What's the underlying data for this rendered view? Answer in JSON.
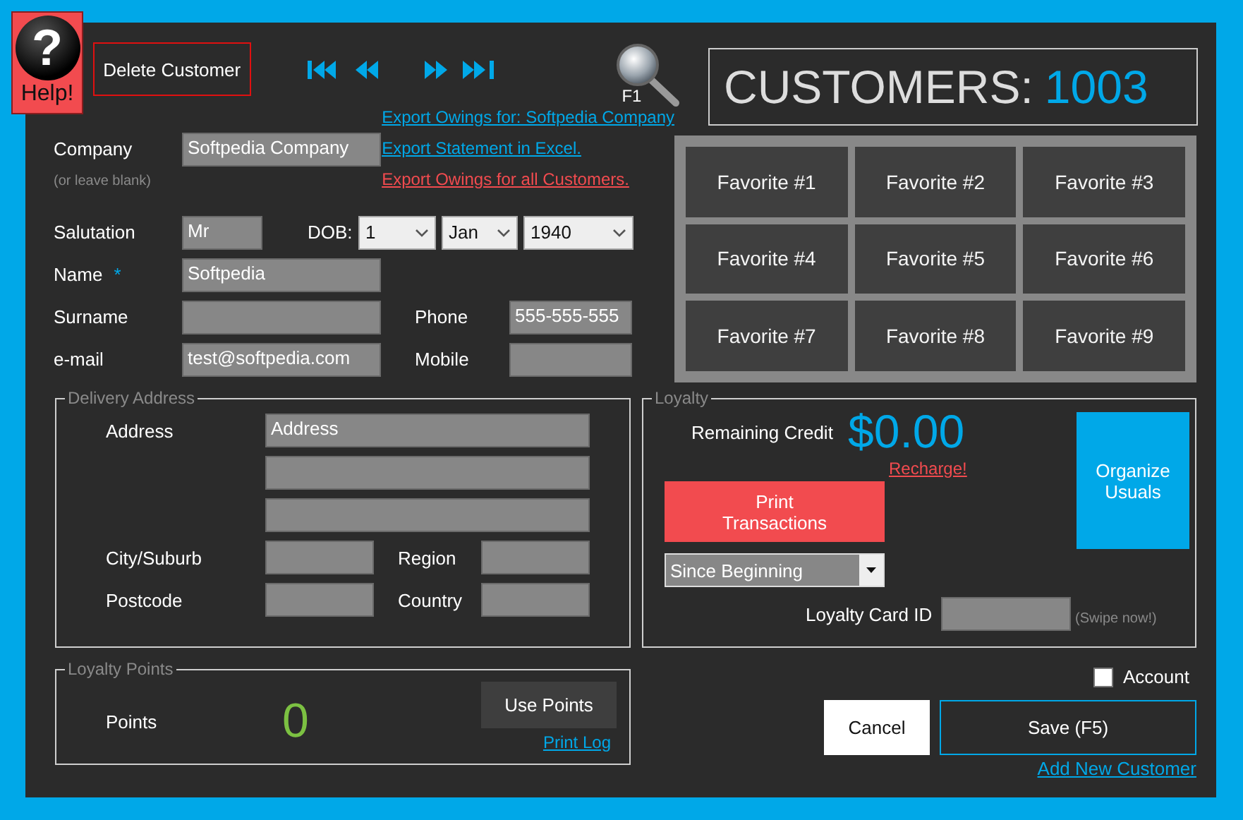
{
  "help_button": {
    "symbol": "?",
    "label": "Help!"
  },
  "delete_button": {
    "label": "Delete Customer"
  },
  "search": {
    "hotkey": "F1"
  },
  "customers": {
    "label": "CUSTOMERS:",
    "count": "1003"
  },
  "export_links": [
    {
      "label": "Export Owings for: Softpedia Company",
      "kind": "standard"
    },
    {
      "label": "Export Statement in Excel.",
      "kind": "standard"
    },
    {
      "label": "Export Owings for all Customers.",
      "kind": "alert"
    }
  ],
  "company": {
    "label": "Company",
    "hint": "(or leave blank)",
    "value": "Softpedia Company"
  },
  "salutation": {
    "label": "Salutation",
    "value": "Mr"
  },
  "dob": {
    "label": "DOB:",
    "day": "1",
    "month": "Jan",
    "year": "1940"
  },
  "name": {
    "label": "Name",
    "required_mark": "*",
    "value": "Softpedia"
  },
  "surname": {
    "label": "Surname"
  },
  "phone": {
    "label": "Phone",
    "value": "555-555-555"
  },
  "email": {
    "label": "e-mail",
    "value": "test@softpedia.com"
  },
  "mobile": {
    "label": "Mobile"
  },
  "favorites": [
    "Favorite #1",
    "Favorite #2",
    "Favorite #3",
    "Favorite #4",
    "Favorite #5",
    "Favorite #6",
    "Favorite #7",
    "Favorite #8",
    "Favorite #9"
  ],
  "delivery": {
    "title": "Delivery Address",
    "address_label": "Address",
    "address_value": "Address",
    "city_label": "City/Suburb",
    "region_label": "Region",
    "postcode_label": "Postcode",
    "country_label": "Country"
  },
  "loyalty": {
    "title": "Loyalty",
    "credit_label": "Remaining Credit",
    "credit": "$0.00",
    "recharge_link": "Recharge!",
    "print_button": "Print Transactions",
    "period": "Since Beginning",
    "card_label": "Loyalty Card ID",
    "swipe_hint": "(Swipe now!)",
    "organize_button": "Organize Usuals"
  },
  "loyalty_points": {
    "title": "Loyalty Points",
    "label": "Points",
    "value": "0",
    "use_button": "Use Points",
    "print_log_link": "Print Log"
  },
  "account": {
    "label": "Account",
    "checked": false
  },
  "cancel_button": "Cancel",
  "save_button": "Save (F5)",
  "add_new_link": "Add New Customer"
}
